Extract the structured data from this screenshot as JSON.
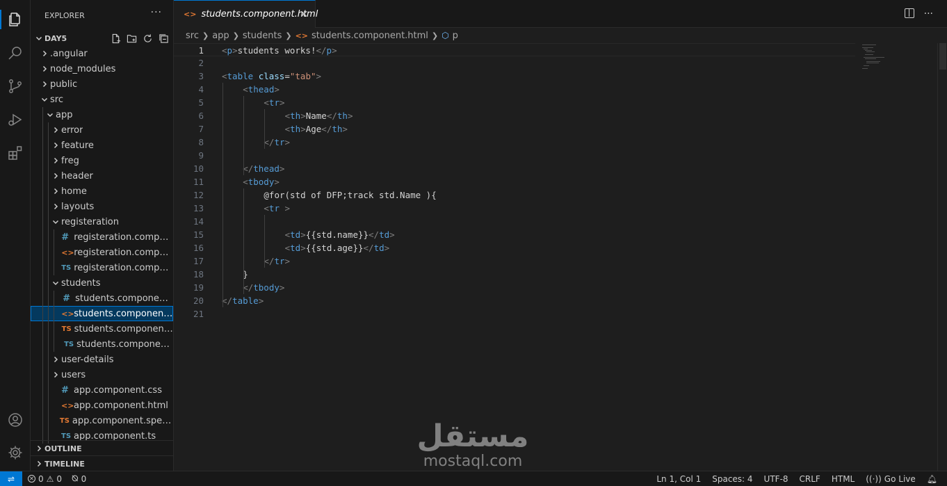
{
  "sidebar": {
    "title": "EXPLORER",
    "more": "···",
    "workspace": "DAY5",
    "outline": "OUTLINE",
    "timeline": "TIMELINE",
    "tree": [
      {
        "label": ".angular",
        "type": "folder",
        "depth": 0,
        "open": false
      },
      {
        "label": "node_modules",
        "type": "folder",
        "depth": 0,
        "open": false
      },
      {
        "label": "public",
        "type": "folder",
        "depth": 0,
        "open": false
      },
      {
        "label": "src",
        "type": "folder",
        "depth": 0,
        "open": true
      },
      {
        "label": "app",
        "type": "folder",
        "depth": 1,
        "open": true
      },
      {
        "label": "error",
        "type": "folder",
        "depth": 2,
        "open": false
      },
      {
        "label": "feature",
        "type": "folder",
        "depth": 2,
        "open": false
      },
      {
        "label": "freg",
        "type": "folder",
        "depth": 2,
        "open": false
      },
      {
        "label": "header",
        "type": "folder",
        "depth": 2,
        "open": false
      },
      {
        "label": "home",
        "type": "folder",
        "depth": 2,
        "open": false
      },
      {
        "label": "layouts",
        "type": "folder",
        "depth": 2,
        "open": false
      },
      {
        "label": "registeration",
        "type": "folder",
        "depth": 2,
        "open": true
      },
      {
        "label": "registeration.componen...",
        "type": "css",
        "depth": 3
      },
      {
        "label": "registeration.componen...",
        "type": "html",
        "depth": 3
      },
      {
        "label": "registeration.componen...",
        "type": "ts",
        "depth": 3
      },
      {
        "label": "students",
        "type": "folder",
        "depth": 2,
        "open": true
      },
      {
        "label": "students.component.css",
        "type": "css",
        "depth": 3
      },
      {
        "label": "students.component.html",
        "type": "html",
        "depth": 3,
        "selected": true
      },
      {
        "label": "students.component.sp...",
        "type": "spec",
        "depth": 3
      },
      {
        "label": "students.component.ts",
        "type": "ts",
        "depth": 3
      },
      {
        "label": "user-details",
        "type": "folder",
        "depth": 2,
        "open": false
      },
      {
        "label": "users",
        "type": "folder",
        "depth": 2,
        "open": false
      },
      {
        "label": "app.component.css",
        "type": "css",
        "depth": 2
      },
      {
        "label": "app.component.html",
        "type": "html",
        "depth": 2
      },
      {
        "label": "app.component.spec.ts",
        "type": "spec",
        "depth": 2
      },
      {
        "label": "app.component.ts",
        "type": "ts",
        "depth": 2
      }
    ]
  },
  "icons": {
    "css": "#",
    "html": "<>",
    "ts": "TS",
    "spec": "TS"
  },
  "tab": {
    "label": "students.component.html",
    "close": "✕"
  },
  "breadcrumb": {
    "parts": [
      "src",
      "app",
      "students",
      "students.component.html",
      "p"
    ]
  },
  "editor": {
    "lines": [
      {
        "n": "1",
        "indent": 0,
        "tokens": [
          [
            "br",
            "<"
          ],
          [
            "tag",
            "p"
          ],
          [
            "br",
            ">"
          ],
          [
            "txt",
            "students works!"
          ],
          [
            "br",
            "</"
          ],
          [
            "tag",
            "p"
          ],
          [
            "br",
            ">"
          ]
        ]
      },
      {
        "n": "2",
        "indent": 0,
        "tokens": []
      },
      {
        "n": "3",
        "indent": 0,
        "tokens": [
          [
            "br",
            "<"
          ],
          [
            "tag",
            "table"
          ],
          [
            "txt",
            " "
          ],
          [
            "attr",
            "class"
          ],
          [
            "txt",
            "="
          ],
          [
            "str",
            "\"tab\""
          ],
          [
            "br",
            ">"
          ]
        ]
      },
      {
        "n": "4",
        "indent": 1,
        "tokens": [
          [
            "br",
            "<"
          ],
          [
            "tag",
            "thead"
          ],
          [
            "br",
            ">"
          ]
        ]
      },
      {
        "n": "5",
        "indent": 2,
        "tokens": [
          [
            "br",
            "<"
          ],
          [
            "tag",
            "tr"
          ],
          [
            "br",
            ">"
          ]
        ]
      },
      {
        "n": "6",
        "indent": 3,
        "tokens": [
          [
            "br",
            "<"
          ],
          [
            "tag",
            "th"
          ],
          [
            "br",
            ">"
          ],
          [
            "txt",
            "Name"
          ],
          [
            "br",
            "</"
          ],
          [
            "tag",
            "th"
          ],
          [
            "br",
            ">"
          ]
        ]
      },
      {
        "n": "7",
        "indent": 3,
        "tokens": [
          [
            "br",
            "<"
          ],
          [
            "tag",
            "th"
          ],
          [
            "br",
            ">"
          ],
          [
            "txt",
            "Age"
          ],
          [
            "br",
            "</"
          ],
          [
            "tag",
            "th"
          ],
          [
            "br",
            ">"
          ]
        ]
      },
      {
        "n": "8",
        "indent": 2,
        "tokens": [
          [
            "br",
            "</"
          ],
          [
            "tag",
            "tr"
          ],
          [
            "br",
            ">"
          ]
        ]
      },
      {
        "n": "9",
        "indent": 0,
        "tokens": []
      },
      {
        "n": "10",
        "indent": 1,
        "tokens": [
          [
            "br",
            "</"
          ],
          [
            "tag",
            "thead"
          ],
          [
            "br",
            ">"
          ]
        ]
      },
      {
        "n": "11",
        "indent": 1,
        "tokens": [
          [
            "br",
            "<"
          ],
          [
            "tag",
            "tbody"
          ],
          [
            "br",
            ">"
          ]
        ]
      },
      {
        "n": "12",
        "indent": 2,
        "tokens": [
          [
            "txt",
            "@for(std of DFP;track std.Name ){"
          ]
        ]
      },
      {
        "n": "13",
        "indent": 2,
        "tokens": [
          [
            "br",
            "<"
          ],
          [
            "tag",
            "tr"
          ],
          [
            "txt",
            " "
          ],
          [
            "br",
            ">"
          ]
        ]
      },
      {
        "n": "14",
        "indent": 0,
        "tokens": []
      },
      {
        "n": "15",
        "indent": 3,
        "tokens": [
          [
            "br",
            "<"
          ],
          [
            "tag",
            "td"
          ],
          [
            "br",
            ">"
          ],
          [
            "txt",
            "{{std.name}}"
          ],
          [
            "br",
            "</"
          ],
          [
            "tag",
            "td"
          ],
          [
            "br",
            ">"
          ]
        ]
      },
      {
        "n": "16",
        "indent": 3,
        "tokens": [
          [
            "br",
            "<"
          ],
          [
            "tag",
            "td"
          ],
          [
            "br",
            ">"
          ],
          [
            "txt",
            "{{std.age}}"
          ],
          [
            "br",
            "</"
          ],
          [
            "tag",
            "td"
          ],
          [
            "br",
            ">"
          ]
        ]
      },
      {
        "n": "17",
        "indent": 2,
        "tokens": [
          [
            "br",
            "</"
          ],
          [
            "tag",
            "tr"
          ],
          [
            "br",
            ">"
          ]
        ]
      },
      {
        "n": "18",
        "indent": 1,
        "tokens": [
          [
            "txt",
            "}"
          ]
        ]
      },
      {
        "n": "19",
        "indent": 1,
        "tokens": [
          [
            "br",
            "</"
          ],
          [
            "tag",
            "tbody"
          ],
          [
            "br",
            ">"
          ]
        ]
      },
      {
        "n": "20",
        "indent": 0,
        "tokens": [
          [
            "br",
            "</"
          ],
          [
            "tag",
            "table"
          ],
          [
            "br",
            ">"
          ]
        ]
      },
      {
        "n": "21",
        "indent": 0,
        "tokens": []
      }
    ],
    "current_line": "1"
  },
  "watermark": {
    "arabic": "مستقل",
    "latin": "mostaql.com"
  },
  "status": {
    "errors": "0",
    "warnings": "0",
    "ports": "0",
    "position": "Ln 1, Col 1",
    "spaces": "Spaces: 4",
    "encoding": "UTF-8",
    "eol": "CRLF",
    "language": "HTML",
    "golive": "Go Live"
  },
  "colors": {
    "accent": "#0078d4",
    "tag": "#569cd6",
    "attr": "#9cdcfe",
    "string": "#ce9178",
    "html_icon": "#e37933",
    "css_icon": "#519aba"
  }
}
